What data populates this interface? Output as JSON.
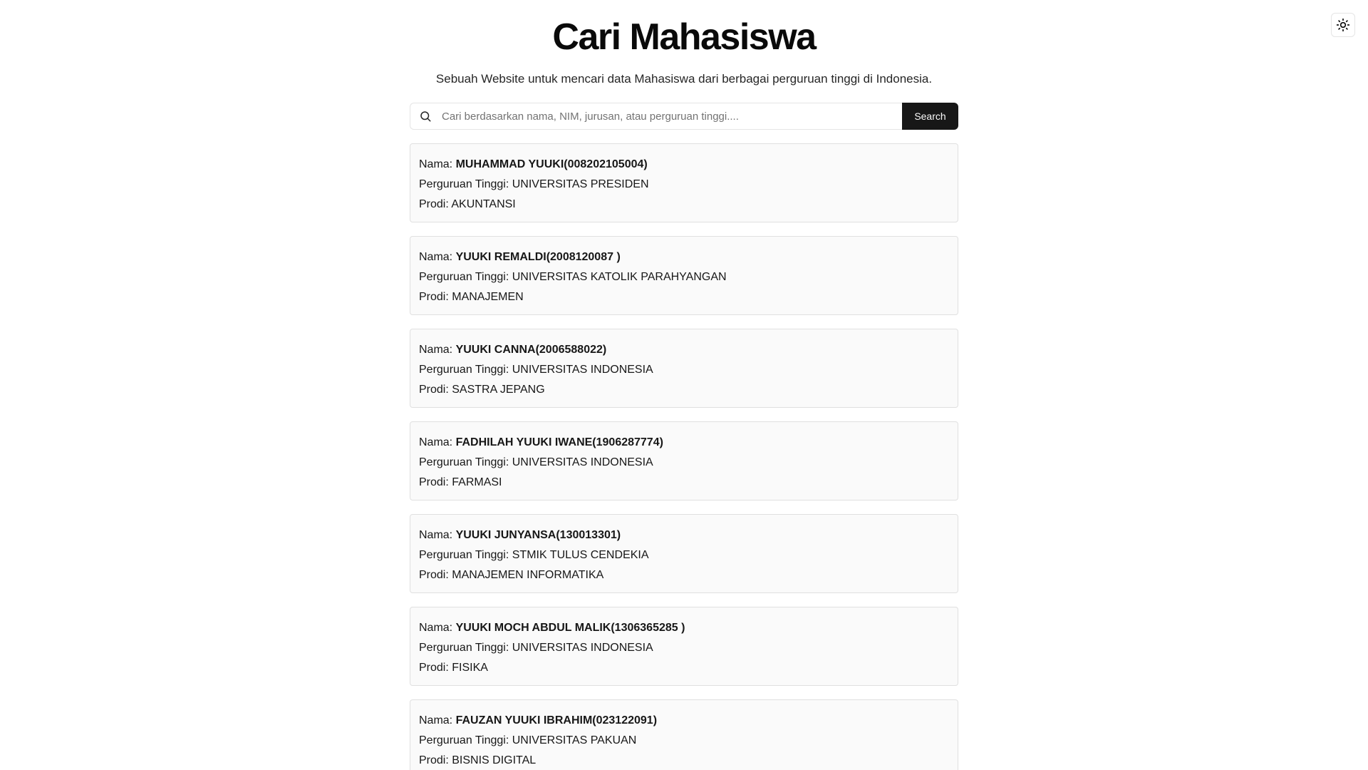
{
  "header": {
    "title": "Cari Mahasiswa",
    "subtitle": "Sebuah Website untuk mencari data Mahasiswa dari berbagai perguruan tinggi di Indonesia."
  },
  "theme_toggle": {
    "icon": "sun-icon"
  },
  "search": {
    "placeholder": "Cari berdasarkan nama, NIM, jurusan, atau perguruan tinggi....",
    "value": "",
    "button_label": "Search",
    "icon": "search-icon"
  },
  "labels": {
    "nama": "Nama: ",
    "perguruan_tinggi": "Perguruan Tinggi: ",
    "prodi": "Prodi: "
  },
  "results": [
    {
      "nama": "MUHAMMAD YUUKI(008202105004)",
      "perguruan_tinggi": "UNIVERSITAS PRESIDEN",
      "prodi": "AKUNTANSI"
    },
    {
      "nama": "YUUKI REMALDI(2008120087 )",
      "perguruan_tinggi": "UNIVERSITAS KATOLIK PARAHYANGAN",
      "prodi": "MANAJEMEN"
    },
    {
      "nama": "YUUKI CANNA(2006588022)",
      "perguruan_tinggi": "UNIVERSITAS INDONESIA",
      "prodi": "SASTRA JEPANG"
    },
    {
      "nama": "FADHILAH YUUKI IWANE(1906287774)",
      "perguruan_tinggi": "UNIVERSITAS INDONESIA",
      "prodi": "FARMASI"
    },
    {
      "nama": "YUUKI JUNYANSA(130013301)",
      "perguruan_tinggi": "STMIK TULUS CENDEKIA",
      "prodi": "MANAJEMEN INFORMATIKA"
    },
    {
      "nama": "YUUKI MOCH ABDUL MALIK(1306365285 )",
      "perguruan_tinggi": "UNIVERSITAS INDONESIA",
      "prodi": "FISIKA"
    },
    {
      "nama": "FAUZAN YUUKI IBRAHIM(023122091)",
      "perguruan_tinggi": "UNIVERSITAS PAKUAN",
      "prodi": "BISNIS DIGITAL"
    }
  ]
}
